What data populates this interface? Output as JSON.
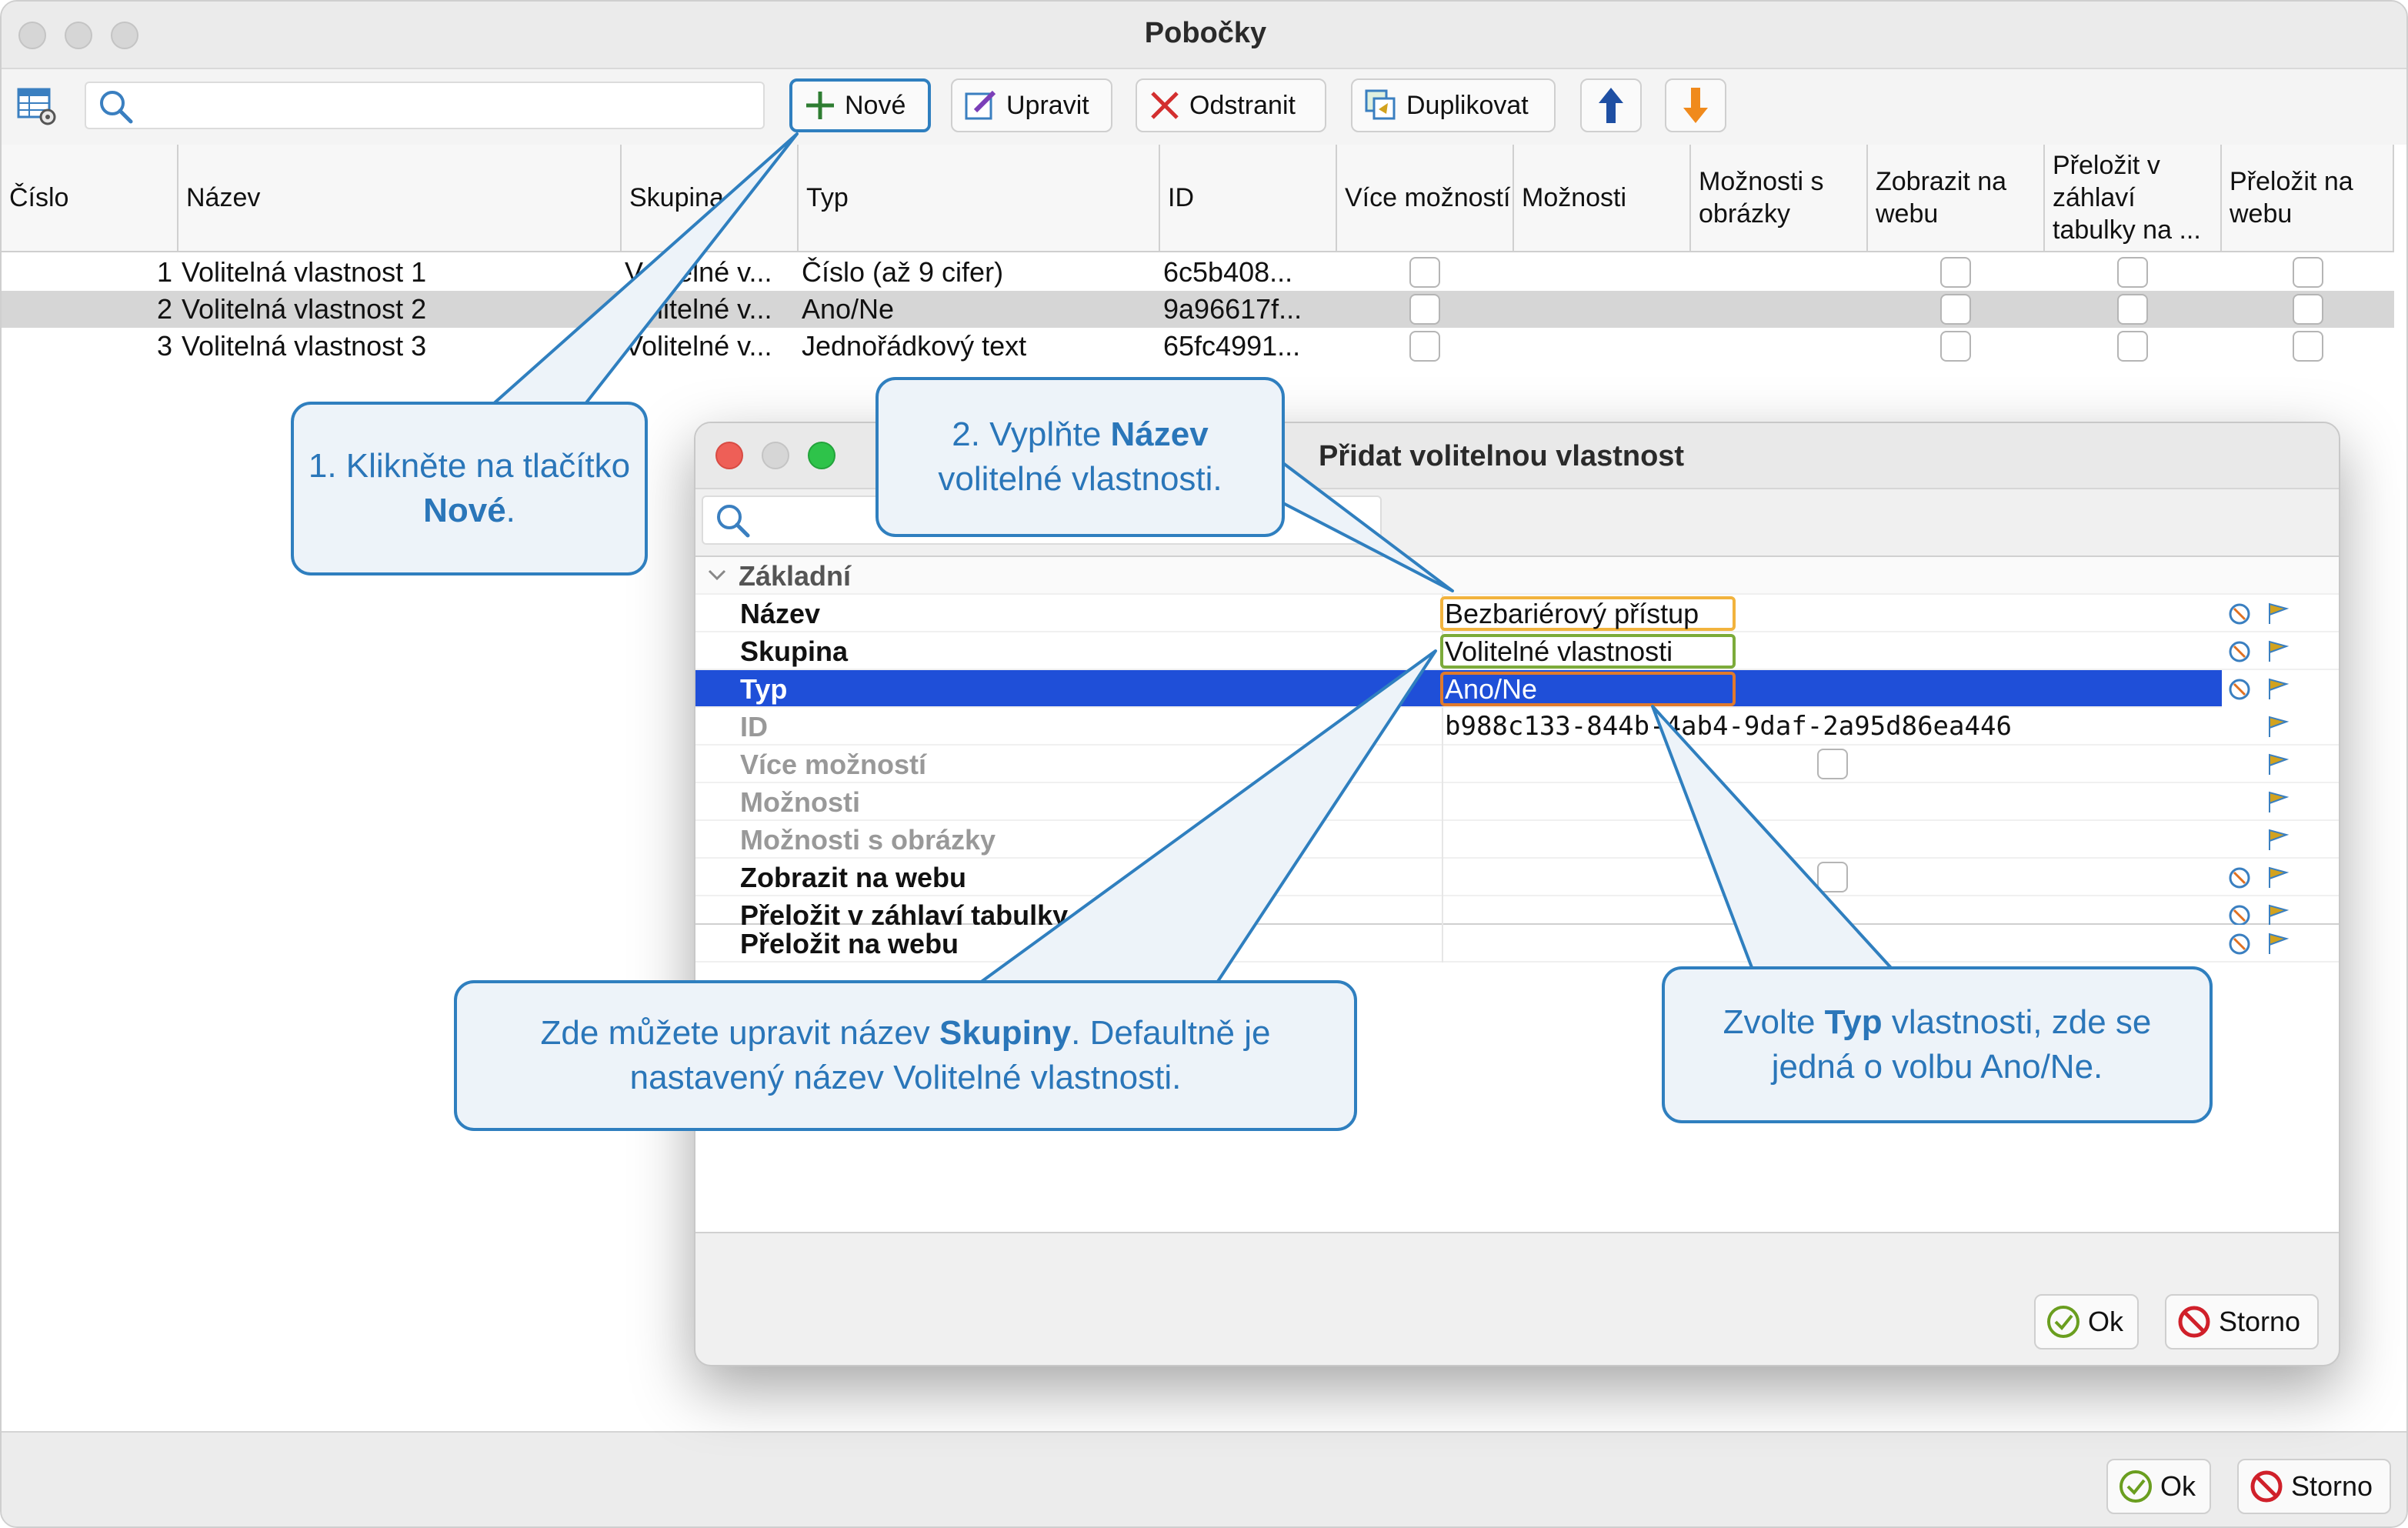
{
  "window": {
    "title": "Pobočky"
  },
  "toolbar": {
    "new_label": "Nové",
    "edit_label": "Upravit",
    "delete_label": "Odstranit",
    "duplicate_label": "Duplikovat"
  },
  "table": {
    "columns": [
      "Číslo",
      "Název",
      "Skupina",
      "Typ",
      "ID",
      "Více možností",
      "Možnosti",
      "Možnosti s obrázky",
      "Zobrazit na webu",
      "Přeložit v záhlaví tabulky na ...",
      "Přeložit na webu"
    ],
    "rows": [
      {
        "num": "1",
        "name": "Volitelná vlastnost 1",
        "group": "Volitelné v...",
        "type": "Číslo (až 9 cifer)",
        "id": "6c5b408..."
      },
      {
        "num": "2",
        "name": "Volitelná vlastnost 2",
        "group": "Volitelné v...",
        "type": "Ano/Ne",
        "id": "9a96617f..."
      },
      {
        "num": "3",
        "name": "Volitelná vlastnost 3",
        "group": "Volitelné v...",
        "type": "Jednořádkový text",
        "id": "65fc4991..."
      }
    ]
  },
  "dialog": {
    "title": "Přidat volitelnou vlastnost",
    "section": "Základní",
    "props": [
      {
        "name": "Název",
        "value": "Bezbariérový přístup"
      },
      {
        "name": "Skupina",
        "value": "Volitelné vlastnosti"
      },
      {
        "name": "Typ",
        "value": "Ano/Ne"
      },
      {
        "name": "ID",
        "value": "b988c133-844b-4ab4-9daf-2a95d86ea446"
      },
      {
        "name": "Více možností",
        "value": ""
      },
      {
        "name": "Možnosti",
        "value": ""
      },
      {
        "name": "Možnosti s obrázky",
        "value": ""
      },
      {
        "name": "Zobrazit na webu",
        "value": ""
      },
      {
        "name": "Přeložit v záhlaví tabulky",
        "value": ""
      },
      {
        "name": "Přeložit na webu",
        "value": ""
      }
    ],
    "ok_label": "Ok",
    "cancel_label": "Storno"
  },
  "footer": {
    "ok_label": "Ok",
    "cancel_label": "Storno"
  },
  "callouts": {
    "c1_a": "1. Klikněte na tlačítko ",
    "c1_b": "Nové",
    "c1_c": ".",
    "c2_a": "2. Vyplňte ",
    "c2_b": "Název",
    "c2_c": "volitelné vlastnosti.",
    "c3_a": "Zde můžete upravit název ",
    "c3_b": "Skupiny",
    "c3_c": ". Defaultně je nastavený název Volitelné vlastnosti.",
    "c4_a": "Zvolte ",
    "c4_b": "Typ",
    "c4_c": " vlastnosti, zde se jedná o volbu Ano/Ne."
  },
  "colors": {
    "selection": "#1f4fd8",
    "callout_border": "#2f7fbf",
    "callout_text": "#2a76b9"
  }
}
